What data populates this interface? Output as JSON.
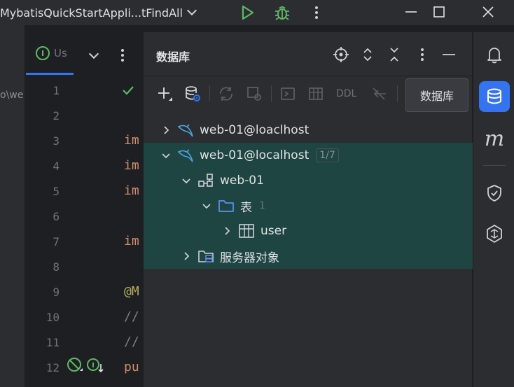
{
  "titlebar": {
    "run_config": "MybatisQuickStartAppli...tFindAll"
  },
  "left_strip": {
    "path_fragment": "o\\we"
  },
  "editor": {
    "tab_label": "Us",
    "line_numbers": [
      "1",
      "2",
      "3",
      "4",
      "5",
      "6",
      "7",
      "8",
      "9",
      "10",
      "11",
      "12"
    ],
    "code_fragments": [
      {
        "line": 3,
        "text": "im",
        "cls": "kw"
      },
      {
        "line": 4,
        "text": "im",
        "cls": "kw"
      },
      {
        "line": 5,
        "text": "im",
        "cls": "kw"
      },
      {
        "line": 7,
        "text": "im",
        "cls": "kw"
      },
      {
        "line": 9,
        "text": "@M",
        "cls": "anno"
      },
      {
        "line": 10,
        "text": "//",
        "cls": "cmt"
      },
      {
        "line": 11,
        "text": "//",
        "cls": "cmt"
      },
      {
        "line": 12,
        "text": "pu",
        "cls": "kw"
      }
    ]
  },
  "db_panel": {
    "title": "数据库",
    "toolbar": {
      "ddl_label": "DDL"
    },
    "tooltip": "数据库",
    "tree": [
      {
        "label": "web-01@loaclhost",
        "indent": 0,
        "expanded": false,
        "icon": "mysql-icon",
        "selected": false
      },
      {
        "label": "web-01@localhost",
        "indent": 0,
        "expanded": true,
        "icon": "mysql-icon",
        "selected": true,
        "badge": "1/7"
      },
      {
        "label": "web-01",
        "indent": 1,
        "expanded": true,
        "icon": "schema-icon",
        "selected": true
      },
      {
        "label": "表",
        "indent": 2,
        "expanded": true,
        "icon": "folder-icon",
        "selected": true,
        "count": "1"
      },
      {
        "label": "user",
        "indent": 3,
        "expanded": false,
        "icon": "table-icon",
        "selected": true
      },
      {
        "label": "服务器对象",
        "indent": 1,
        "expanded": false,
        "icon": "server-objects-icon",
        "selected": true
      }
    ]
  },
  "right_strip": {
    "items": [
      "notifications-icon",
      "database-icon",
      "mybatis-icon",
      "security-icon",
      "ai-assistant-icon"
    ],
    "mybatis_letter": "m"
  },
  "colors": {
    "accent": "#3574f0",
    "selection": "#1e4541",
    "run_green": "#5fb865",
    "mysql_blue": "#4aa3df"
  }
}
